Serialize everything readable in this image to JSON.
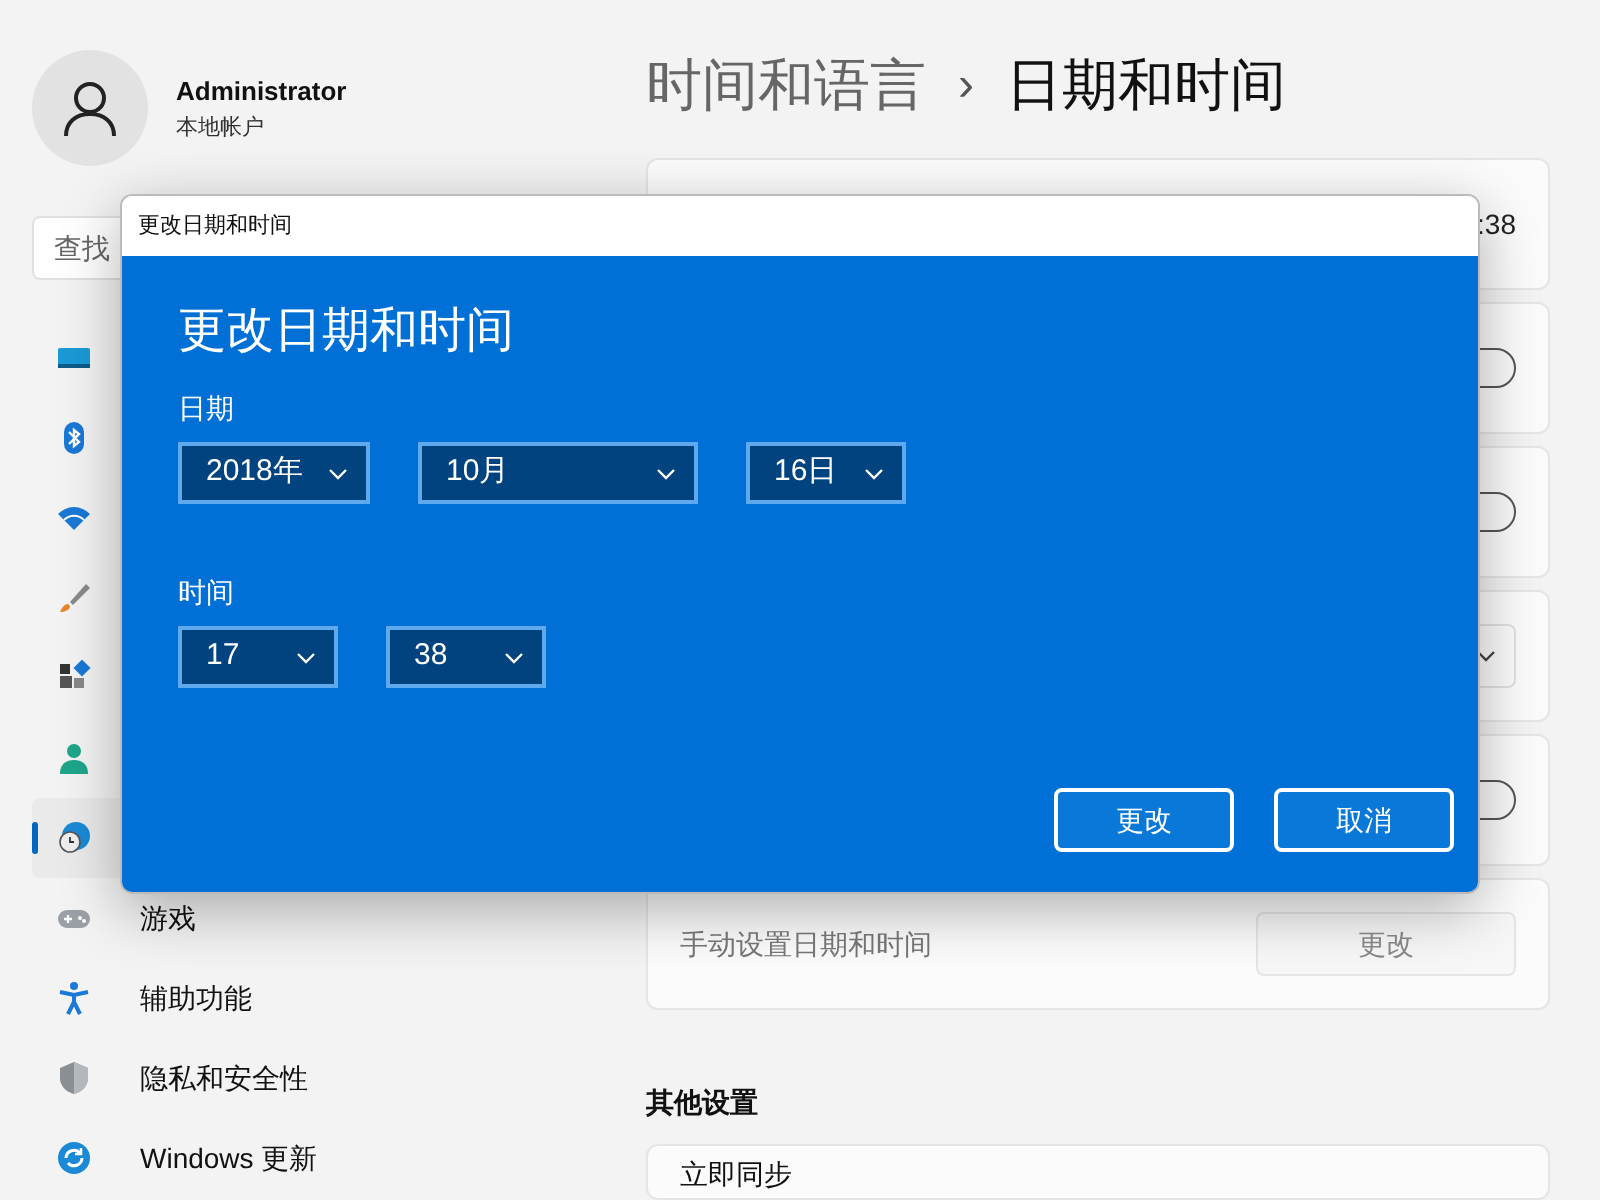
{
  "account": {
    "name": "Administrator",
    "type": "本地帐户"
  },
  "search": {
    "placeholder": "查找"
  },
  "nav": [
    {
      "selected": false
    },
    {
      "selected": false
    },
    {
      "selected": false
    },
    {
      "selected": false
    },
    {
      "selected": false
    },
    {
      "selected": false
    },
    {
      "selected": true
    },
    {
      "label": "游戏",
      "selected": false
    },
    {
      "label": "辅助功能",
      "selected": false
    },
    {
      "label": "隐私和安全性",
      "selected": false
    },
    {
      "label": "Windows 更新",
      "selected": false
    }
  ],
  "breadcrumb": {
    "parent": "时间和语言",
    "separator": "›",
    "current": "日期和时间"
  },
  "settings": [
    {
      "kind": "value",
      "text": ":38"
    },
    {
      "kind": "toggle",
      "on": false
    },
    {
      "kind": "toggle",
      "on": false
    },
    {
      "kind": "dropdown"
    },
    {
      "kind": "toggle",
      "on": false
    },
    {
      "kind": "action",
      "label": "手动设置日期和时间",
      "button": "更改",
      "disabled": true
    }
  ],
  "other_settings": {
    "title": "其他设置",
    "items": [
      {
        "label": "立即同步"
      }
    ]
  },
  "dialog": {
    "window_title": "更改日期和时间",
    "heading": "更改日期和时间",
    "date": {
      "label": "日期",
      "fields": [
        {
          "value": "2018年"
        },
        {
          "value": "10月"
        },
        {
          "value": "16日"
        }
      ]
    },
    "time": {
      "label": "时间",
      "fields": [
        {
          "value": "17"
        },
        {
          "value": "38"
        }
      ]
    },
    "buttons": [
      {
        "label": "更改"
      },
      {
        "label": "取消"
      }
    ]
  }
}
